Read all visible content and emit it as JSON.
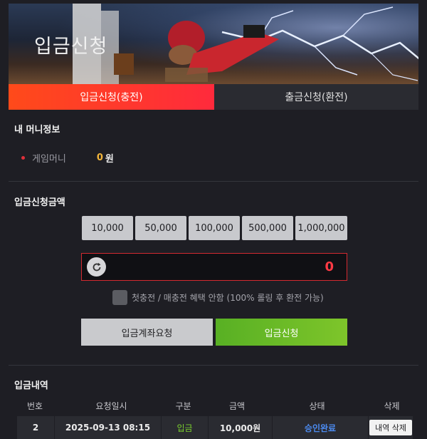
{
  "banner": {
    "title": "입금신청"
  },
  "tabs": [
    {
      "label": "입금신청(충전)",
      "active": true
    },
    {
      "label": "출금신청(환전)",
      "active": false
    }
  ],
  "money_info": {
    "title": "내 머니정보",
    "label": "게임머니",
    "value": "0",
    "unit": "원"
  },
  "deposit": {
    "title": "입금신청금액",
    "amount_buttons": [
      "10,000",
      "50,000",
      "100,000",
      "500,000",
      "1,000,000"
    ],
    "amount_value": "0",
    "refresh_icon": "refresh-icon",
    "checkbox_label": "첫충전 / 매충전 혜택 안함 (100% 롤링 후 환전 가능)",
    "account_request_label": "입금계좌요청",
    "submit_label": "입금신청"
  },
  "history": {
    "title": "입금내역",
    "columns": [
      "번호",
      "요청일시",
      "구분",
      "금액",
      "상태",
      "삭제"
    ],
    "rows": [
      {
        "no": "2",
        "datetime": "2025-09-13 08:15",
        "type": "입금",
        "amount": "10,000원",
        "status": "승인완료",
        "delete_label": "내역 삭제"
      }
    ]
  },
  "colors": {
    "accent_red": "#ff2a3c",
    "accent_green": "#6bbd28",
    "status_blue": "#4c8cf2",
    "money_gold": "#f4b63a"
  }
}
